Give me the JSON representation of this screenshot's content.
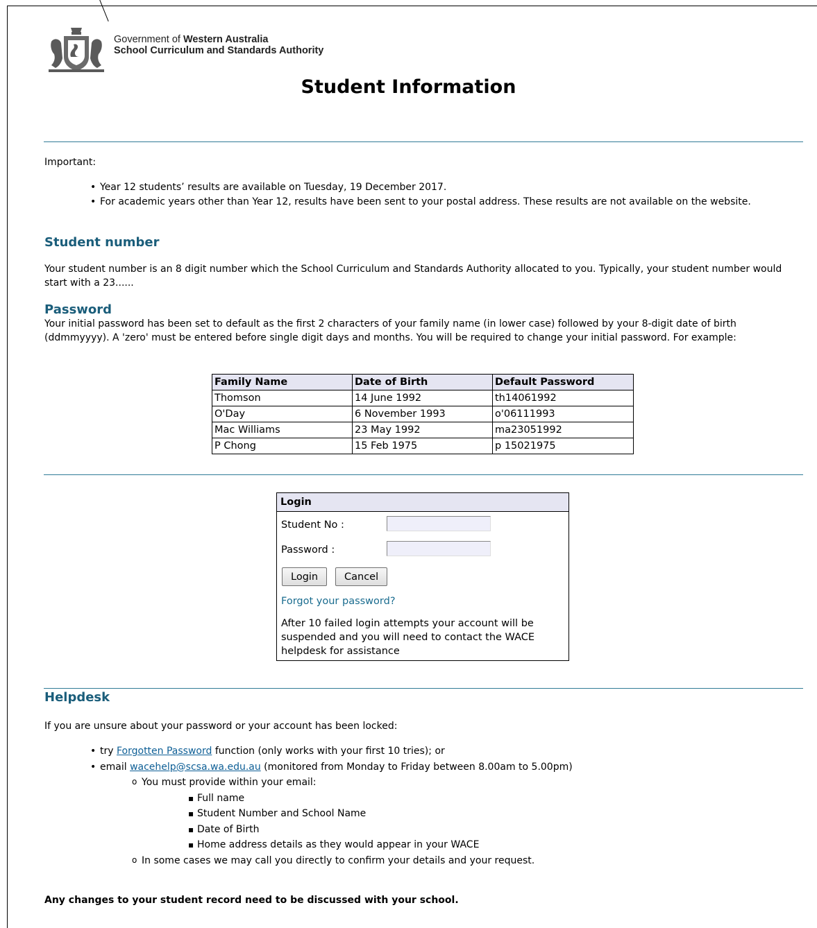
{
  "header": {
    "gov_prefix": "Government of ",
    "gov_bold": "Western Australia",
    "authority": "School Curriculum and Standards Authority"
  },
  "page_title": "Student Information",
  "important_label": "Important:",
  "important_items": [
    "Year 12 students’ results are available on Tuesday, 19 December 2017.",
    "For academic years other than Year 12, results have been sent to your postal address. These results are not available on the website."
  ],
  "student_number": {
    "heading": "Student number",
    "text": "Your student number is an 8 digit number which the School Curriculum and Standards Authority allocated to you. Typically, your student number would start with  a 23......"
  },
  "password": {
    "heading": "Password",
    "text": "Your initial password has been set to default as the first 2 characters of your family name (in lower case) followed by your 8-digit date of birth (ddmmyyyy). A 'zero' must be entered before single digit days and months. You will be required to change your initial password. For example:",
    "table_headers": [
      "Family Name",
      "Date of Birth",
      "Default Password"
    ],
    "table_rows": [
      [
        "Thomson",
        "14 June 1992",
        "th14061992"
      ],
      [
        "O'Day",
        "6 November 1993",
        "o'06111993"
      ],
      [
        "Mac Williams",
        "23 May 1992",
        "ma23051992"
      ],
      [
        "P Chong",
        "15 Feb 1975",
        "p 15021975"
      ]
    ]
  },
  "login": {
    "heading": "Login",
    "student_no_label": "Student No :",
    "password_label": "Password :",
    "student_no_value": "",
    "password_value": "",
    "login_button": "Login",
    "cancel_button": "Cancel",
    "forgot_link": "Forgot your password?",
    "note": "After 10 failed login attempts your account will be suspended and you will need to contact the WACE helpdesk for assistance"
  },
  "helpdesk": {
    "heading": "Helpdesk",
    "intro": "If you are unsure about your password or your account has been locked:",
    "try_prefix": "try ",
    "try_link": "Forgotten Password",
    "try_suffix": " function (only works with your first 10 tries); or",
    "email_prefix": "email ",
    "email_link": "wacehelp@scsa.wa.edu.au",
    "email_suffix": " (monitored from Monday to Friday between 8.00am to 5.00pm)",
    "must_provide": "You must provide within your email:",
    "details": [
      "Full name",
      "Student Number and School Name",
      "Date of Birth",
      "Home address details as they would appear in your WACE"
    ],
    "may_call": "In some cases we may call you directly to confirm your details and your request."
  },
  "footer_note": "Any changes to your student record need to be discussed with your school."
}
